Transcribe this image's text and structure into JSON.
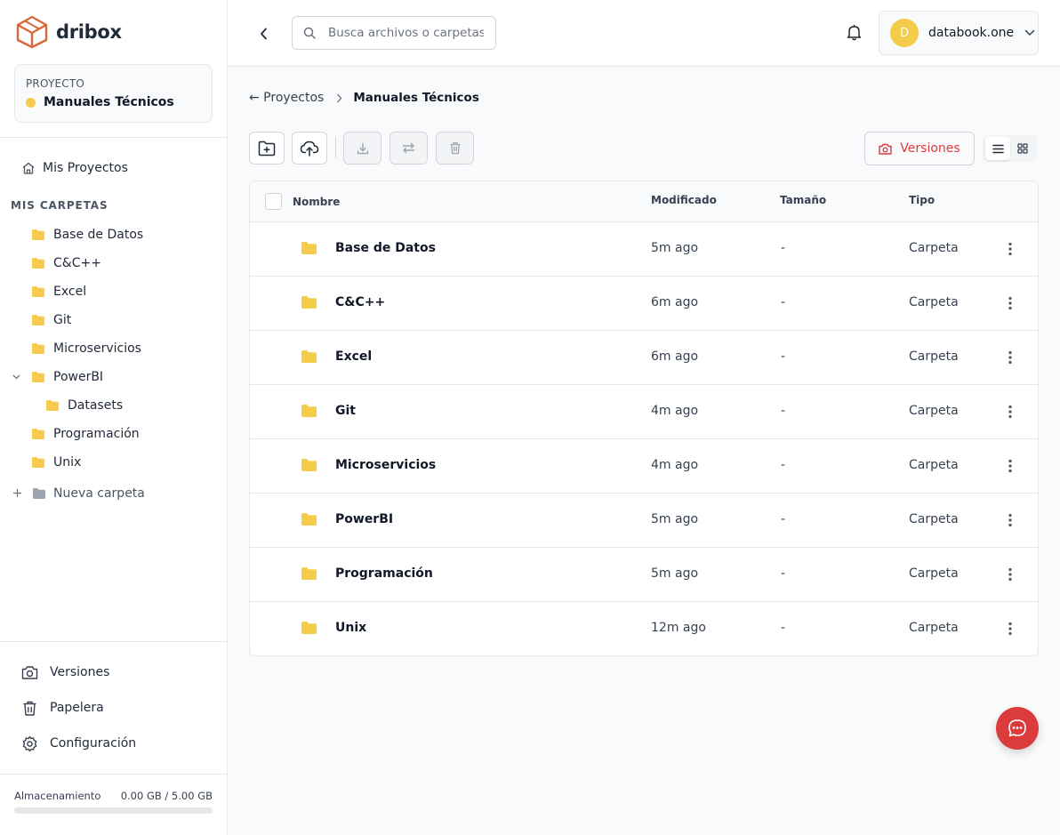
{
  "app": {
    "name": "dribox"
  },
  "project": {
    "label": "PROYECTO",
    "name": "Manuales Técnicos"
  },
  "nav": {
    "home_label": "Mis Proyectos"
  },
  "folders_section": {
    "title": "MIS CARPETAS",
    "items": [
      {
        "label": "Base de Datos"
      },
      {
        "label": "C&C++"
      },
      {
        "label": "Excel"
      },
      {
        "label": "Git"
      },
      {
        "label": "Microservicios"
      },
      {
        "label": "PowerBI",
        "expanded": true
      },
      {
        "label": "Datasets",
        "child": true
      },
      {
        "label": "Programación"
      },
      {
        "label": "Unix"
      }
    ],
    "new_folder_label": "Nueva carpeta"
  },
  "sidebar_bottom": {
    "versions_label": "Versiones",
    "trash_label": "Papelera",
    "settings_label": "Configuración"
  },
  "storage": {
    "label": "Almacenamiento",
    "usage": "0.00 GB / 5.00 GB",
    "used_fraction": 0.0
  },
  "header": {
    "search_placeholder": "Busca archivos o carpetas...",
    "user_initial": "D",
    "user_name": "databook.one"
  },
  "breadcrumb": {
    "back_label": "← Proyectos",
    "current": "Manuales Técnicos"
  },
  "toolbar": {
    "versions_label": "Versiones"
  },
  "table": {
    "columns": {
      "name": "Nombre",
      "modified": "Modificado",
      "size": "Tamaño",
      "type": "Tipo"
    },
    "rows": [
      {
        "name": "Base de Datos",
        "modified": "5m ago",
        "size": "-",
        "type": "Carpeta"
      },
      {
        "name": "C&C++",
        "modified": "6m ago",
        "size": "-",
        "type": "Carpeta"
      },
      {
        "name": "Excel",
        "modified": "6m ago",
        "size": "-",
        "type": "Carpeta"
      },
      {
        "name": "Git",
        "modified": "4m ago",
        "size": "-",
        "type": "Carpeta"
      },
      {
        "name": "Microservicios",
        "modified": "4m ago",
        "size": "-",
        "type": "Carpeta"
      },
      {
        "name": "PowerBI",
        "modified": "5m ago",
        "size": "-",
        "type": "Carpeta"
      },
      {
        "name": "Programación",
        "modified": "5m ago",
        "size": "-",
        "type": "Carpeta"
      },
      {
        "name": "Unix",
        "modified": "12m ago",
        "size": "-",
        "type": "Carpeta"
      }
    ]
  },
  "colors": {
    "accent": "#dc3b3b",
    "folder": "#f5cb4a",
    "logo": "#d9683a",
    "avatar": "#f5cb4a"
  },
  "icons": {
    "logo": "cube-icon",
    "home": "home-icon",
    "folder": "folder-icon",
    "new_folder": "plus-icon",
    "versions": "camera-icon",
    "trash": "trash-icon",
    "settings": "gear-icon",
    "search": "search-icon",
    "bell": "bell-icon",
    "back": "chevron-left-icon",
    "chat": "chat-bubble-icon"
  }
}
